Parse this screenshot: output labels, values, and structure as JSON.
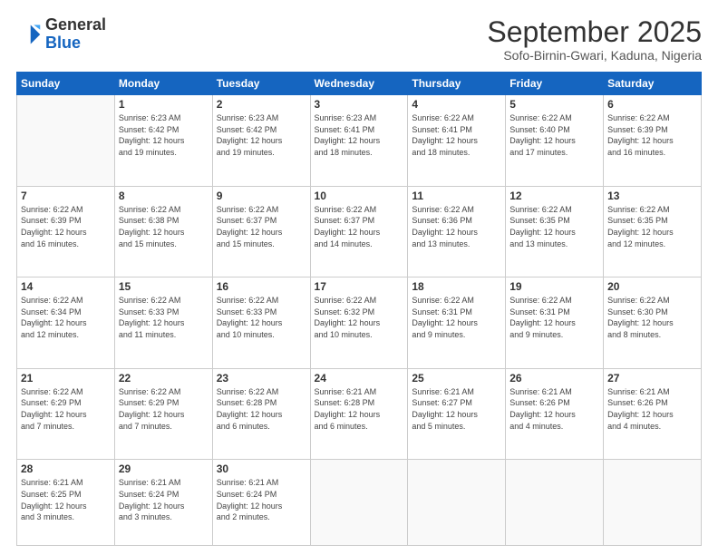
{
  "header": {
    "logo_general": "General",
    "logo_blue": "Blue",
    "month_title": "September 2025",
    "subtitle": "Sofo-Birnin-Gwari, Kaduna, Nigeria"
  },
  "weekdays": [
    "Sunday",
    "Monday",
    "Tuesday",
    "Wednesday",
    "Thursday",
    "Friday",
    "Saturday"
  ],
  "weeks": [
    [
      {
        "day": "",
        "info": ""
      },
      {
        "day": "1",
        "info": "Sunrise: 6:23 AM\nSunset: 6:42 PM\nDaylight: 12 hours\nand 19 minutes."
      },
      {
        "day": "2",
        "info": "Sunrise: 6:23 AM\nSunset: 6:42 PM\nDaylight: 12 hours\nand 19 minutes."
      },
      {
        "day": "3",
        "info": "Sunrise: 6:23 AM\nSunset: 6:41 PM\nDaylight: 12 hours\nand 18 minutes."
      },
      {
        "day": "4",
        "info": "Sunrise: 6:22 AM\nSunset: 6:41 PM\nDaylight: 12 hours\nand 18 minutes."
      },
      {
        "day": "5",
        "info": "Sunrise: 6:22 AM\nSunset: 6:40 PM\nDaylight: 12 hours\nand 17 minutes."
      },
      {
        "day": "6",
        "info": "Sunrise: 6:22 AM\nSunset: 6:39 PM\nDaylight: 12 hours\nand 16 minutes."
      }
    ],
    [
      {
        "day": "7",
        "info": "Sunrise: 6:22 AM\nSunset: 6:39 PM\nDaylight: 12 hours\nand 16 minutes."
      },
      {
        "day": "8",
        "info": "Sunrise: 6:22 AM\nSunset: 6:38 PM\nDaylight: 12 hours\nand 15 minutes."
      },
      {
        "day": "9",
        "info": "Sunrise: 6:22 AM\nSunset: 6:37 PM\nDaylight: 12 hours\nand 15 minutes."
      },
      {
        "day": "10",
        "info": "Sunrise: 6:22 AM\nSunset: 6:37 PM\nDaylight: 12 hours\nand 14 minutes."
      },
      {
        "day": "11",
        "info": "Sunrise: 6:22 AM\nSunset: 6:36 PM\nDaylight: 12 hours\nand 13 minutes."
      },
      {
        "day": "12",
        "info": "Sunrise: 6:22 AM\nSunset: 6:35 PM\nDaylight: 12 hours\nand 13 minutes."
      },
      {
        "day": "13",
        "info": "Sunrise: 6:22 AM\nSunset: 6:35 PM\nDaylight: 12 hours\nand 12 minutes."
      }
    ],
    [
      {
        "day": "14",
        "info": "Sunrise: 6:22 AM\nSunset: 6:34 PM\nDaylight: 12 hours\nand 12 minutes."
      },
      {
        "day": "15",
        "info": "Sunrise: 6:22 AM\nSunset: 6:33 PM\nDaylight: 12 hours\nand 11 minutes."
      },
      {
        "day": "16",
        "info": "Sunrise: 6:22 AM\nSunset: 6:33 PM\nDaylight: 12 hours\nand 10 minutes."
      },
      {
        "day": "17",
        "info": "Sunrise: 6:22 AM\nSunset: 6:32 PM\nDaylight: 12 hours\nand 10 minutes."
      },
      {
        "day": "18",
        "info": "Sunrise: 6:22 AM\nSunset: 6:31 PM\nDaylight: 12 hours\nand 9 minutes."
      },
      {
        "day": "19",
        "info": "Sunrise: 6:22 AM\nSunset: 6:31 PM\nDaylight: 12 hours\nand 9 minutes."
      },
      {
        "day": "20",
        "info": "Sunrise: 6:22 AM\nSunset: 6:30 PM\nDaylight: 12 hours\nand 8 minutes."
      }
    ],
    [
      {
        "day": "21",
        "info": "Sunrise: 6:22 AM\nSunset: 6:29 PM\nDaylight: 12 hours\nand 7 minutes."
      },
      {
        "day": "22",
        "info": "Sunrise: 6:22 AM\nSunset: 6:29 PM\nDaylight: 12 hours\nand 7 minutes."
      },
      {
        "day": "23",
        "info": "Sunrise: 6:22 AM\nSunset: 6:28 PM\nDaylight: 12 hours\nand 6 minutes."
      },
      {
        "day": "24",
        "info": "Sunrise: 6:21 AM\nSunset: 6:28 PM\nDaylight: 12 hours\nand 6 minutes."
      },
      {
        "day": "25",
        "info": "Sunrise: 6:21 AM\nSunset: 6:27 PM\nDaylight: 12 hours\nand 5 minutes."
      },
      {
        "day": "26",
        "info": "Sunrise: 6:21 AM\nSunset: 6:26 PM\nDaylight: 12 hours\nand 4 minutes."
      },
      {
        "day": "27",
        "info": "Sunrise: 6:21 AM\nSunset: 6:26 PM\nDaylight: 12 hours\nand 4 minutes."
      }
    ],
    [
      {
        "day": "28",
        "info": "Sunrise: 6:21 AM\nSunset: 6:25 PM\nDaylight: 12 hours\nand 3 minutes."
      },
      {
        "day": "29",
        "info": "Sunrise: 6:21 AM\nSunset: 6:24 PM\nDaylight: 12 hours\nand 3 minutes."
      },
      {
        "day": "30",
        "info": "Sunrise: 6:21 AM\nSunset: 6:24 PM\nDaylight: 12 hours\nand 2 minutes."
      },
      {
        "day": "",
        "info": ""
      },
      {
        "day": "",
        "info": ""
      },
      {
        "day": "",
        "info": ""
      },
      {
        "day": "",
        "info": ""
      }
    ]
  ]
}
